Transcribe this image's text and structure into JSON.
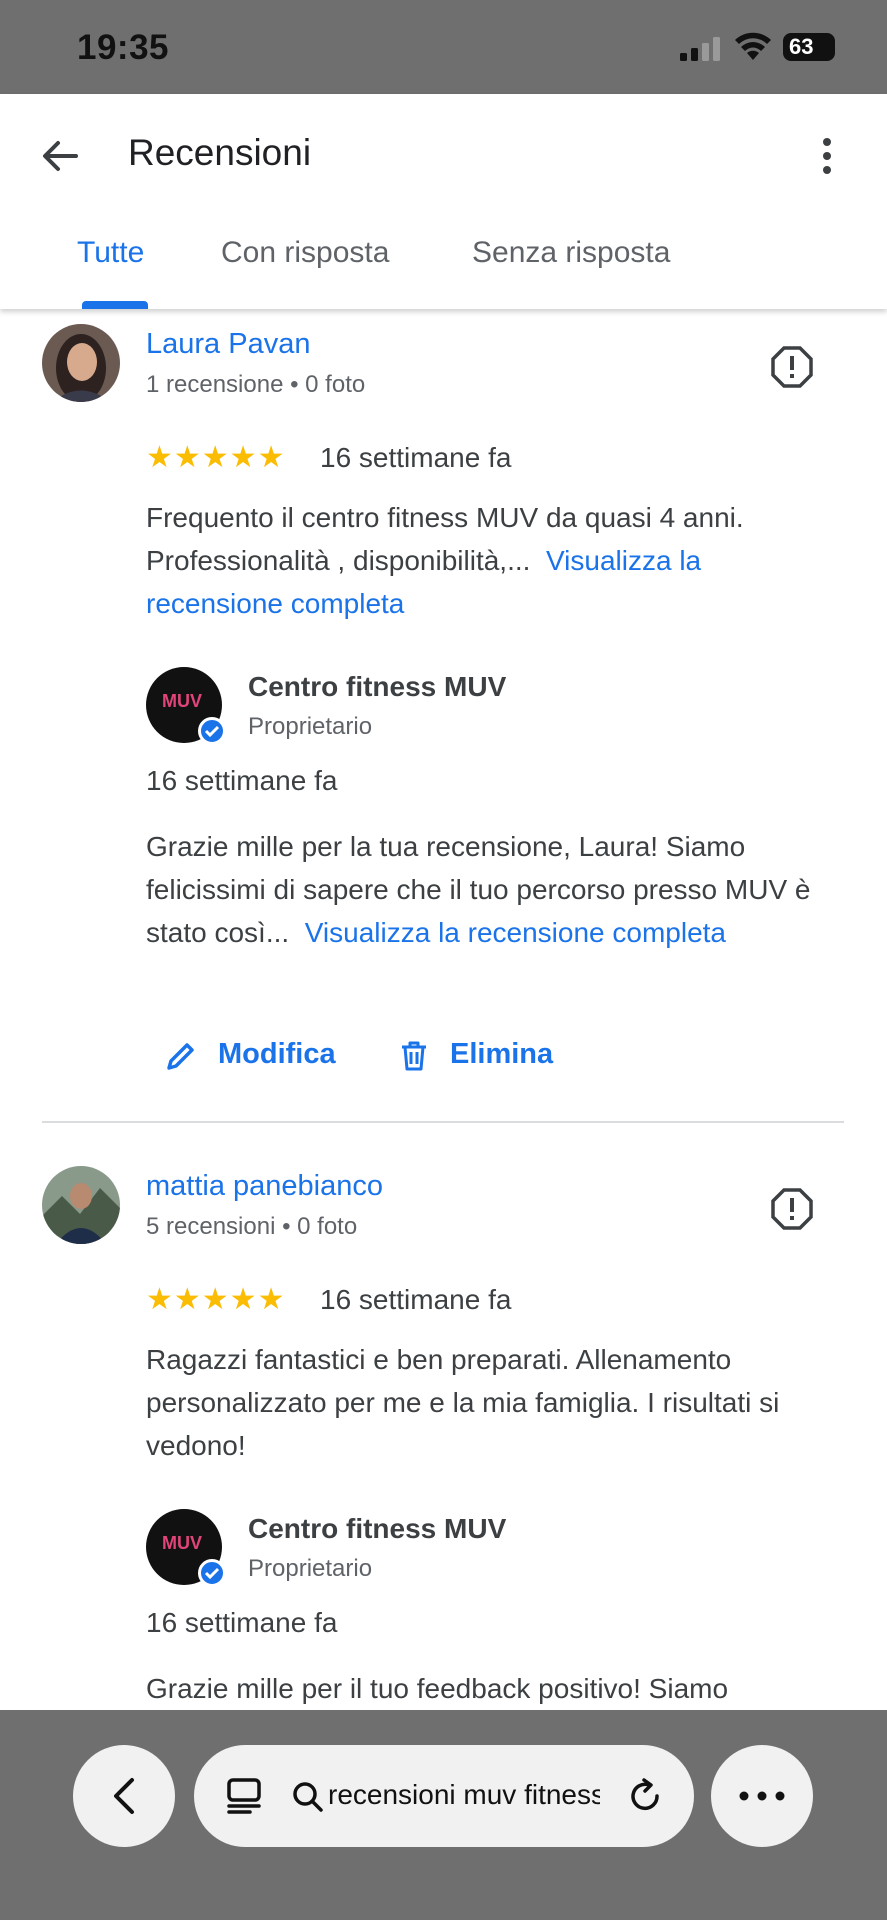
{
  "status_bar": {
    "time": "19:35",
    "battery": "63"
  },
  "header": {
    "title": "Recensioni"
  },
  "tabs": [
    {
      "label": "Tutte",
      "active": true
    },
    {
      "label": "Con risposta",
      "active": false
    },
    {
      "label": "Senza risposta",
      "active": false
    }
  ],
  "reviews": [
    {
      "author": "Laura Pavan",
      "author_stats": "1 recensione • 0 foto",
      "rating": 5,
      "stars": "★★★★★",
      "time_ago": "16 settimane fa",
      "text": "Frequento il centro fitness MUV da quasi 4 anni. Professionalità , disponibilità,...",
      "more_link": "Visualizza la recensione completa",
      "reply": {
        "owner_name": "Centro fitness MUV",
        "owner_role": "Proprietario",
        "time_ago": "16 settimane fa",
        "text": "Grazie mille per la tua recensione, Laura! Siamo felicissimi di sapere che il tuo percorso presso MUV è stato così...",
        "more_link": "Visualizza la recensione completa"
      },
      "actions": {
        "edit": "Modifica",
        "delete": "Elimina"
      }
    },
    {
      "author": "mattia panebianco",
      "author_stats": "5 recensioni • 0 foto",
      "rating": 5,
      "stars": "★★★★★",
      "time_ago": "16 settimane fa",
      "text": "Ragazzi fantastici e ben preparati. Allenamento personalizzato per me e la mia famiglia. I risultati si vedono!",
      "reply": {
        "owner_name": "Centro fitness MUV",
        "owner_role": "Proprietario",
        "time_ago": "16 settimane fa",
        "text": "Grazie mille per il tuo feedback positivo! Siamo"
      }
    }
  ],
  "owner_logo_text": "MUV",
  "browser": {
    "url_text": "recensioni muv fitness"
  },
  "icons": [
    "back-arrow-icon",
    "more-vert-icon",
    "flag-icon",
    "edit-pencil-icon",
    "trash-icon",
    "verified-check-icon",
    "browser-back-icon",
    "tabs-icon",
    "search-icon",
    "reload-icon",
    "more-horiz-icon"
  ],
  "colors": {
    "accent": "#1a73e8",
    "star": "#fbbc04",
    "chrome_gray": "#6f6f6f"
  }
}
